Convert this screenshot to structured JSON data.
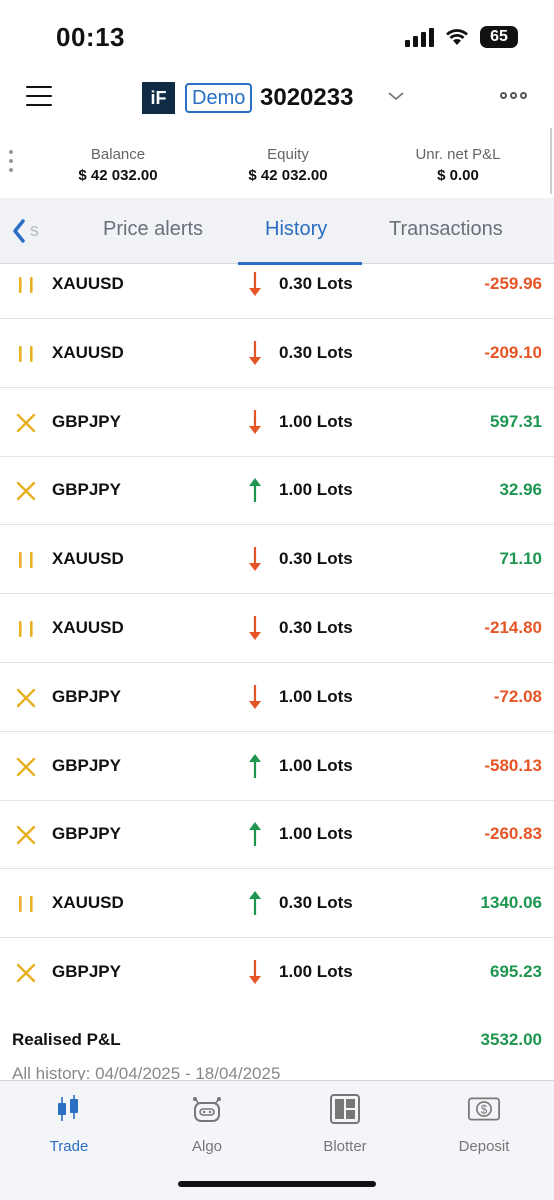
{
  "status_bar": {
    "time": "00:13",
    "battery": "65"
  },
  "header": {
    "logo_text": "iF",
    "demo_label": "Demo",
    "account_number": "3020233"
  },
  "summary": {
    "balance_label": "Balance",
    "balance_value": "$ 42 032.00",
    "equity_label": "Equity",
    "equity_value": "$ 42 032.00",
    "pnl_label": "Unr. net P&L",
    "pnl_value": "$ 0.00"
  },
  "tabs": {
    "partial_label": "s",
    "price_alerts": "Price alerts",
    "history": "History",
    "transactions": "Transactions",
    "active": "History"
  },
  "rows": [
    {
      "icon": "pause-icon",
      "symbol": "XAUUSD",
      "direction": "down",
      "lots": "0.30 Lots",
      "pnl": "-259.96",
      "positive": false
    },
    {
      "icon": "pause-icon",
      "symbol": "XAUUSD",
      "direction": "down",
      "lots": "0.30 Lots",
      "pnl": "-209.10",
      "positive": false
    },
    {
      "icon": "cross-icon",
      "symbol": "GBPJPY",
      "direction": "down",
      "lots": "1.00 Lots",
      "pnl": "597.31",
      "positive": true
    },
    {
      "icon": "cross-icon",
      "symbol": "GBPJPY",
      "direction": "up",
      "lots": "1.00 Lots",
      "pnl": "32.96",
      "positive": true
    },
    {
      "icon": "pause-icon",
      "symbol": "XAUUSD",
      "direction": "down",
      "lots": "0.30 Lots",
      "pnl": "71.10",
      "positive": true
    },
    {
      "icon": "pause-icon",
      "symbol": "XAUUSD",
      "direction": "down",
      "lots": "0.30 Lots",
      "pnl": "-214.80",
      "positive": false
    },
    {
      "icon": "cross-icon",
      "symbol": "GBPJPY",
      "direction": "down",
      "lots": "1.00 Lots",
      "pnl": "-72.08",
      "positive": false
    },
    {
      "icon": "cross-icon",
      "symbol": "GBPJPY",
      "direction": "up",
      "lots": "1.00 Lots",
      "pnl": "-580.13",
      "positive": false
    },
    {
      "icon": "cross-icon",
      "symbol": "GBPJPY",
      "direction": "up",
      "lots": "1.00 Lots",
      "pnl": "-260.83",
      "positive": false
    },
    {
      "icon": "pause-icon",
      "symbol": "XAUUSD",
      "direction": "up",
      "lots": "0.30 Lots",
      "pnl": "1340.06",
      "positive": true
    },
    {
      "icon": "cross-icon",
      "symbol": "GBPJPY",
      "direction": "down",
      "lots": "1.00 Lots",
      "pnl": "695.23",
      "positive": true
    }
  ],
  "realised": {
    "label": "Realised P&L",
    "value": "3532.00",
    "history_range": "All history: 04/04/2025 - 18/04/2025"
  },
  "bottom_nav": [
    {
      "label": "Trade",
      "icon": "candlestick-icon",
      "active": true
    },
    {
      "label": "Algo",
      "icon": "robot-icon",
      "active": false
    },
    {
      "label": "Blotter",
      "icon": "blotter-icon",
      "active": false
    },
    {
      "label": "Deposit",
      "icon": "dollar-bill-icon",
      "active": false
    }
  ],
  "colors": {
    "accent": "#2a6fc4",
    "positive": "#1e9650",
    "negative": "#e65525",
    "icon_gold": "#e8b020",
    "up_arrow": "#1e9650",
    "down_arrow": "#e65525"
  }
}
